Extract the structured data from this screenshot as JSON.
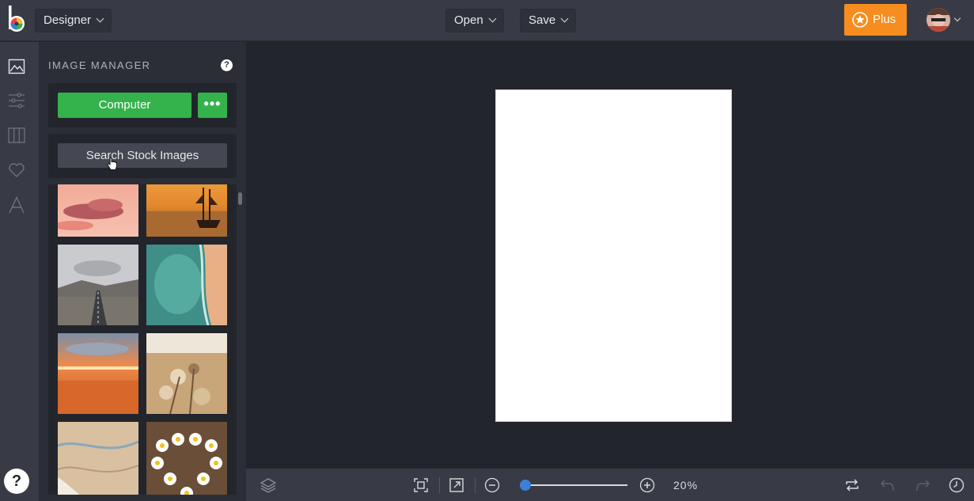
{
  "topbar": {
    "workspace_label": "Designer",
    "open_label": "Open",
    "save_label": "Save",
    "plus_label": "Plus",
    "accent_color": "#f68d1e"
  },
  "sidebar_icons": [
    "image-icon",
    "sliders-icon",
    "columns-icon",
    "heart-icon",
    "text-icon"
  ],
  "panel": {
    "title": "IMAGE MANAGER",
    "help": "?",
    "computer_label": "Computer",
    "more_label": "•••",
    "stock_label": "Search Stock Images",
    "primary_color": "#34b24c",
    "thumbnails": [
      "pink-clouds-sky",
      "sailing-ship-sunset",
      "empty-road-mountains",
      "turquoise-sea-beach-aerial",
      "orange-sunset-beach",
      "dried-flowers-field",
      "sand-desert-aerial",
      "daisies-heart"
    ]
  },
  "help_button": "?",
  "bottombar": {
    "zoom_value": "20%",
    "zoom_fraction": 0.05
  }
}
